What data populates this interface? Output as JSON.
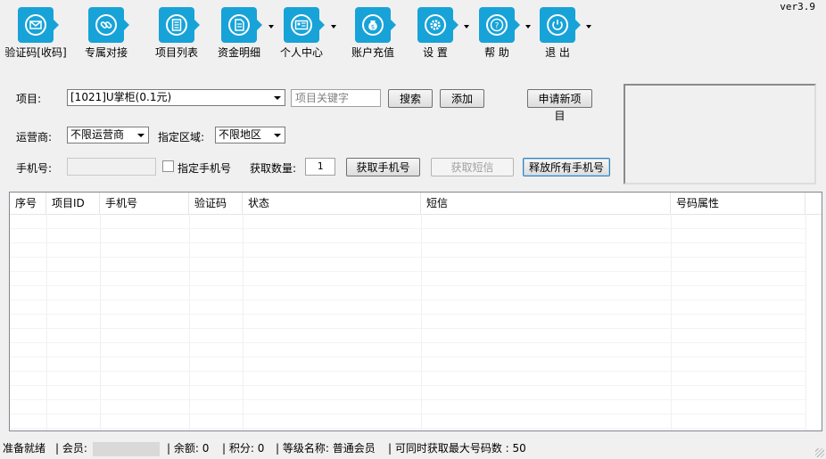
{
  "version": "ver3.9",
  "toolbar": {
    "items": [
      {
        "label": "验证码[收码]",
        "icon": "envelope-icon",
        "dropdown": false
      },
      {
        "label": "专属对接",
        "icon": "link-icon",
        "dropdown": false
      },
      {
        "label": "项目列表",
        "icon": "list-icon",
        "dropdown": false
      },
      {
        "label": "资金明细",
        "icon": "document-icon",
        "dropdown": true
      },
      {
        "label": "个人中心",
        "icon": "id-card-icon",
        "dropdown": true
      },
      {
        "label": "账户充值",
        "icon": "money-bag-icon",
        "dropdown": false
      },
      {
        "label": "设 置",
        "icon": "gear-icon",
        "dropdown": true
      },
      {
        "label": "帮 助",
        "icon": "help-icon",
        "dropdown": true
      },
      {
        "label": "退 出",
        "icon": "power-icon",
        "dropdown": true
      }
    ]
  },
  "form": {
    "project_label": "项目:",
    "project_value": "[1021]U掌柜(0.1元)",
    "keyword_placeholder": "项目关键字",
    "search_label": "搜索",
    "add_label": "添加",
    "apply_label": "申请新项目",
    "carrier_label": "运营商:",
    "carrier_value": "不限运营商",
    "region_label": "指定区域:",
    "region_value": "不限地区",
    "phone_label": "手机号:",
    "phone_value": "",
    "specify_phone_label": "指定手机号",
    "specify_phone_checked": false,
    "count_label": "获取数量:",
    "count_value": "1",
    "get_phone_label": "获取手机号",
    "get_sms_label": "获取短信",
    "release_label": "释放所有手机号"
  },
  "table": {
    "columns": [
      "序号",
      "项目ID",
      "手机号",
      "验证码",
      "状态",
      "短信",
      "号码属性"
    ],
    "rows": []
  },
  "status": {
    "ready": "准备就绪",
    "member_label": "| 会员:",
    "balance": "| 余额:  0",
    "points": "| 积分:  0",
    "level": "| 等级名称:  普通会员",
    "max_numbers": "| 可同时获取最大号码数 :   50"
  },
  "colors": {
    "accent": "#17a3d8"
  }
}
